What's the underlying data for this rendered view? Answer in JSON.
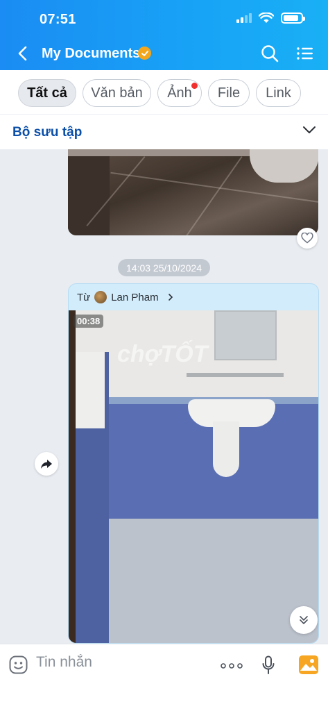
{
  "status_bar": {
    "time": "07:51"
  },
  "header": {
    "title": "My Documents"
  },
  "filters": [
    {
      "label": "Tất cả",
      "active": true
    },
    {
      "label": "Văn bản",
      "active": false
    },
    {
      "label": "Ảnh",
      "active": false,
      "has_dot": true
    },
    {
      "label": "File",
      "active": false
    },
    {
      "label": "Link",
      "active": false
    }
  ],
  "collection": {
    "label": "Bộ sưu tập"
  },
  "chat": {
    "timestamp": "14:03 25/10/2024",
    "message": {
      "from_prefix": "Từ",
      "sender_name": "Lan Pham",
      "video_duration": "00:38",
      "watermark": "chợTỐT"
    }
  },
  "input": {
    "placeholder": "Tin nhắn"
  },
  "colors": {
    "header_blue": "#1a8cf3",
    "accent_orange": "#f4a61c",
    "collection_blue": "#0b4fa8",
    "bubble_blue": "#d2ecfb"
  },
  "icons": [
    "back-icon",
    "verified-icon",
    "search-icon",
    "menu-icon",
    "chevron-down-icon",
    "heart-icon",
    "share-icon",
    "scroll-down-icon",
    "emoji-icon",
    "more-icon",
    "mic-icon",
    "image-icon"
  ]
}
